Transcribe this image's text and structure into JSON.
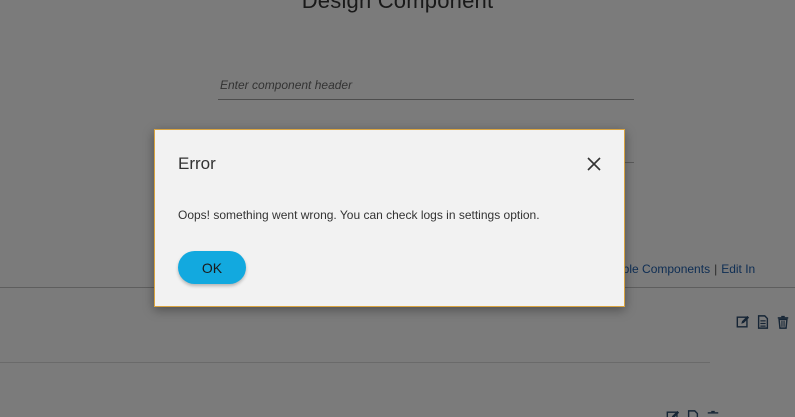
{
  "page": {
    "title": "Design Component",
    "header_input": {
      "value": "",
      "placeholder": "Enter component header"
    },
    "links": {
      "available_components": "ailable Components",
      "separator": "|",
      "edit": "Edit In"
    },
    "row_tool_icons": [
      "edit-icon",
      "document-icon",
      "trash-icon"
    ]
  },
  "modal": {
    "title": "Error",
    "message": "Oops! something went wrong. You can check logs in settings option.",
    "ok_label": "OK",
    "close_icon": "close-icon"
  },
  "colors": {
    "overlay": "rgba(0,0,0,0.5)",
    "ok_button": "#12a9df",
    "modal_border": "#d9a441",
    "link": "#1f5da8"
  }
}
